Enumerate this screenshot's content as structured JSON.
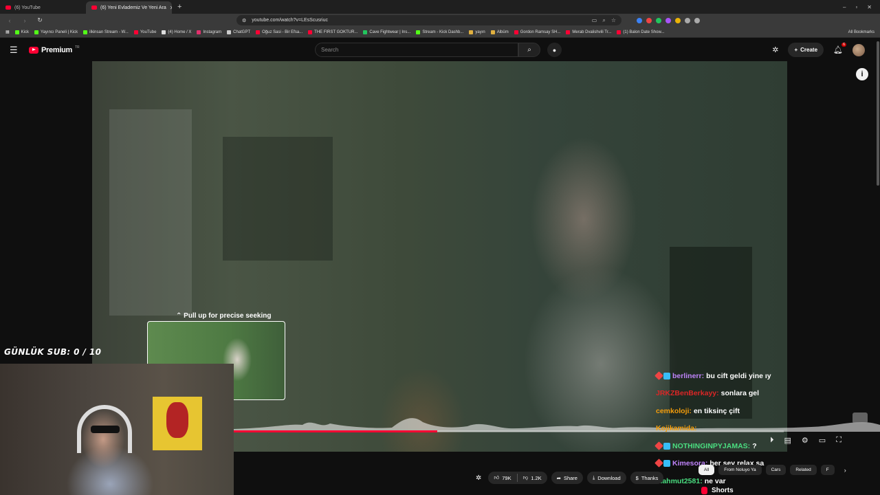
{
  "browser": {
    "tabs": [
      {
        "label": "(6) YouTube",
        "active": false
      },
      {
        "label": "(6) Yeni Evlademiz Ve Yeni Ara",
        "active": true
      }
    ],
    "url": "youtube.com/watch?v=LEsScusriuc",
    "bookmarks": [
      {
        "label": "Kick",
        "color": "#53fc18"
      },
      {
        "label": "Yayıncı Paneli | Kick",
        "color": "#53fc18"
      },
      {
        "label": "ilkinsan Stream - W...",
        "color": "#53fc18"
      },
      {
        "label": "YouTube",
        "color": "#ff0033"
      },
      {
        "label": "(4) Home / X",
        "color": "#dddddd"
      },
      {
        "label": "Instagram",
        "color": "#e1306c"
      },
      {
        "label": "ChatGPT",
        "color": "#cccccc"
      },
      {
        "label": "Oğuz Sasi - Bir Efsa...",
        "color": "#ff0033"
      },
      {
        "label": "THE FIRST GOKTUR...",
        "color": "#ff0033"
      },
      {
        "label": "Cave Fightwear | Ins...",
        "color": "#22c55e"
      },
      {
        "label": "Stream - Kick Dashb...",
        "color": "#53fc18"
      },
      {
        "label": "yayın",
        "color": "#e0b040"
      },
      {
        "label": "Albüm",
        "color": "#e0b040"
      },
      {
        "label": "Gordon Ramsay SH...",
        "color": "#ff0033"
      },
      {
        "label": "Merab Dvalishvili Tr...",
        "color": "#ff0033"
      },
      {
        "label": "(1) Balon Date Show...",
        "color": "#ff0033"
      }
    ],
    "all_bookmarks": "All Bookmarks"
  },
  "youtube": {
    "brand": "Premium",
    "country": "TR",
    "search_placeholder": "Search",
    "create_label": "Create",
    "notification_count": "6"
  },
  "player": {
    "seek_hint": "Pull up for precise seeking",
    "progress_fraction": 0.37
  },
  "overlay": {
    "daily_sub": "GÜNLÜK SUB: 0 / 10"
  },
  "chat": [
    {
      "user": "berlinerr:",
      "text": "bu cift geldi yine ıy",
      "color": "#c084fc",
      "badges": true
    },
    {
      "user": "JRKZBenBerkayy:",
      "text": "sonlara gel",
      "color": "#dc2626",
      "badges": false
    },
    {
      "user": "cemkoloji:",
      "text": "en tiksinç çift",
      "color": "#f59e0b",
      "badges": false
    },
    {
      "user": "Kojikamida:",
      "text": "",
      "color": "#f59e0b",
      "badges": false
    },
    {
      "user": "NOTHINGINPYJAMAS:",
      "text": "?",
      "color": "#4ade80",
      "badges": true
    },
    {
      "user": "Kimesora:",
      "text": "her şey relax sa",
      "color": "#c084fc",
      "badges": true
    },
    {
      "user": "mahmut2581:",
      "text": "ne var",
      "color": "#4ade80",
      "badges": false
    }
  ],
  "actions": {
    "likes": "79K",
    "dislikes": "1.2K",
    "share": "Share",
    "download": "Download",
    "thanks": "Thanks"
  },
  "chips": [
    "All",
    "From Noluyo Ya",
    "Cars",
    "Related",
    "F"
  ],
  "shorts_label": "Shorts"
}
